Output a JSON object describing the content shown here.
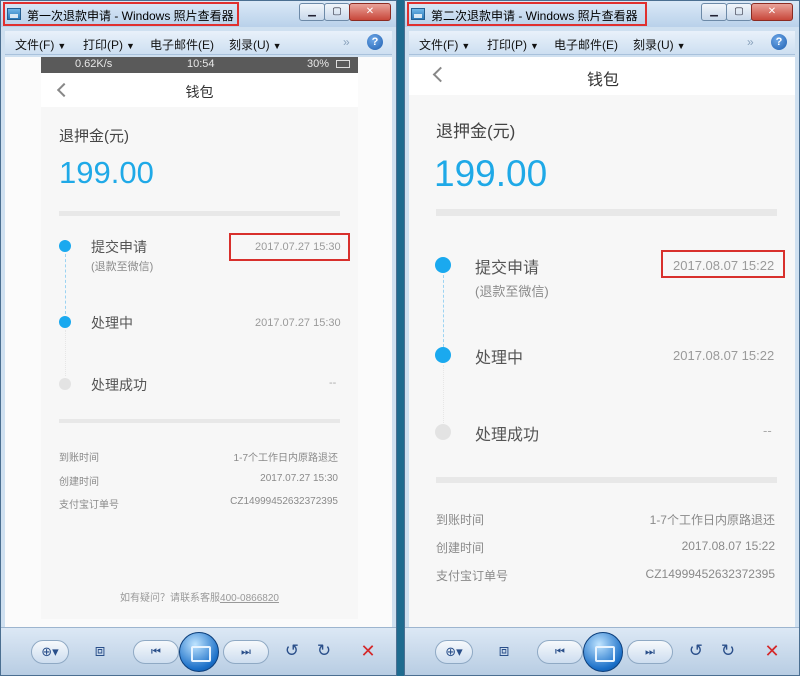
{
  "left": {
    "title": "第一次退款申请 - Windows 照片查看器",
    "menu": [
      "文件(F)",
      "打印(P)",
      "电子邮件(E)",
      "刻录(U)"
    ],
    "status": {
      "net": "0.62K/s",
      "time": "10:54",
      "battery": "30%"
    },
    "nav_title": "钱包",
    "refund_label": "退押金(元)",
    "amount": "199.00",
    "steps": [
      {
        "name": "提交申请",
        "sub": "(退款至微信)",
        "time": "2017.07.27 15:30"
      },
      {
        "name": "处理中",
        "time": "2017.07.27 15:30"
      },
      {
        "name": "处理成功",
        "time": "--"
      }
    ],
    "info": [
      {
        "k": "到账时间",
        "v": "1-7个工作日内原路退还"
      },
      {
        "k": "创建时间",
        "v": "2017.07.27 15:30"
      },
      {
        "k": "支付宝订单号",
        "v": "CZ14999452632372395"
      }
    ],
    "footer": {
      "text": "如有疑问？请联系客服",
      "phone": "400-0866820"
    }
  },
  "right": {
    "title": "第二次退款申请 - Windows 照片查看器",
    "menu": [
      "文件(F)",
      "打印(P)",
      "电子邮件(E)",
      "刻录(U)"
    ],
    "nav_title": "钱包",
    "refund_label": "退押金(元)",
    "amount": "199.00",
    "steps": [
      {
        "name": "提交申请",
        "sub": "(退款至微信)",
        "time": "2017.08.07 15:22"
      },
      {
        "name": "处理中",
        "time": "2017.08.07 15:22"
      },
      {
        "name": "处理成功",
        "time": "--"
      }
    ],
    "info": [
      {
        "k": "到账时间",
        "v": "1-7个工作日内原路退还"
      },
      {
        "k": "创建时间",
        "v": "2017.08.07 15:22"
      },
      {
        "k": "支付宝订单号",
        "v": "CZ14999452632372395"
      }
    ]
  },
  "colors": {
    "accent": "#1aa9ef",
    "highlight_box": "#d8302c"
  },
  "window_controls": [
    "minimize-icon",
    "maximize-icon",
    "close-icon"
  ],
  "toolbar_icons": [
    "zoom-icon",
    "actual-size-icon",
    "previous-icon",
    "slideshow-icon",
    "next-icon",
    "rotate-left-icon",
    "rotate-right-icon",
    "delete-icon"
  ]
}
